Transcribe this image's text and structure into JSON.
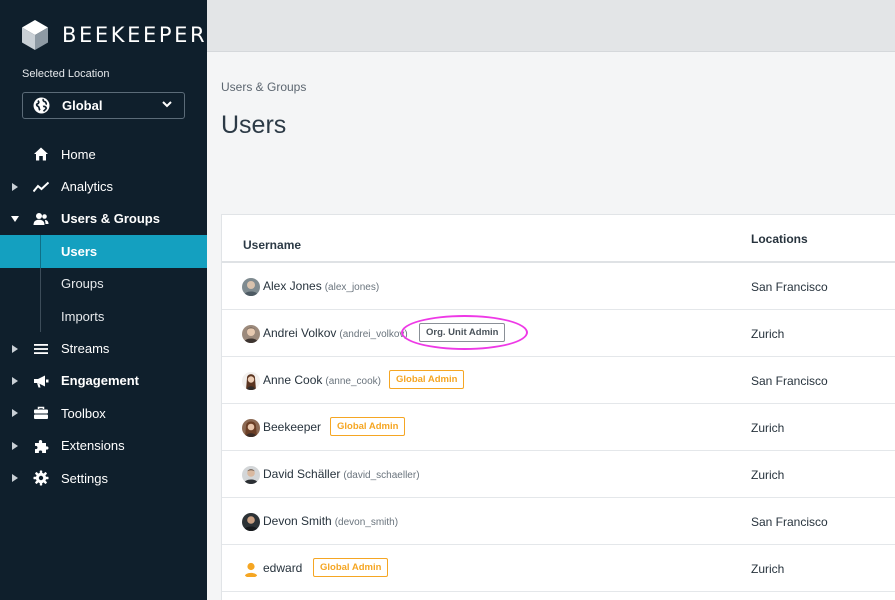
{
  "brand": {
    "name": "BEEKEEPER"
  },
  "location": {
    "label": "Selected Location",
    "value": "Global"
  },
  "nav": {
    "home": "Home",
    "analytics": "Analytics",
    "users_groups": "Users & Groups",
    "users": "Users",
    "groups": "Groups",
    "imports": "Imports",
    "streams": "Streams",
    "engagement": "Engagement",
    "toolbox": "Toolbox",
    "extensions": "Extensions",
    "settings": "Settings"
  },
  "breadcrumb": "Users & Groups",
  "page_title": "Users",
  "table": {
    "headers": {
      "username": "Username",
      "locations": "Locations"
    },
    "rows": [
      {
        "name": "Alex Jones",
        "handle": "(alex_jones)",
        "badge": "",
        "location": "San Francisco"
      },
      {
        "name": "Andrei Volkov",
        "handle": "(andrei_volkov)",
        "badge": "Org. Unit Admin",
        "location": "Zurich"
      },
      {
        "name": "Anne Cook",
        "handle": "(anne_cook)",
        "badge": "Global Admin",
        "location": "San Francisco"
      },
      {
        "name": "Beekeeper",
        "handle": "",
        "badge": "Global Admin",
        "location": "Zurich"
      },
      {
        "name": "David Schäller",
        "handle": "(david_schaeller)",
        "badge": "",
        "location": "Zurich"
      },
      {
        "name": "Devon Smith",
        "handle": "(devon_smith)",
        "badge": "",
        "location": "San Francisco"
      },
      {
        "name": "edward",
        "handle": "",
        "badge": "Global Admin",
        "location": "Zurich"
      }
    ]
  },
  "colors": {
    "sidebar_bg": "#0f1f2c",
    "active_nav": "#14a0c0",
    "global_admin": "#f5a623",
    "highlight": "#ee39e6"
  },
  "icons": [
    "beekeeper-logo-icon",
    "globe-icon",
    "chevron-down-icon",
    "home-icon",
    "analytics-icon",
    "users-icon",
    "streams-icon",
    "megaphone-icon",
    "toolbox-icon",
    "puzzle-icon",
    "gear-icon"
  ]
}
